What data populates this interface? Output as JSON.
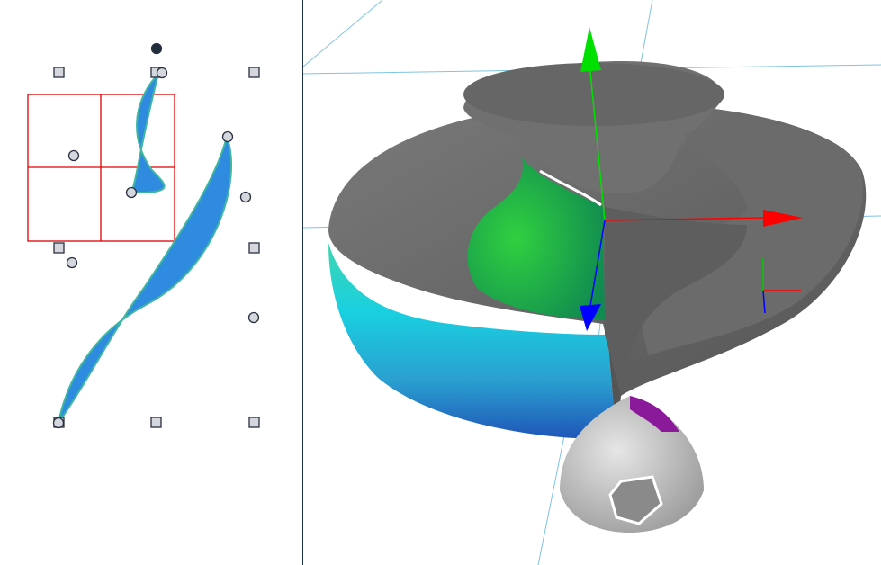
{
  "app": {
    "layout": "two-pane",
    "left_pane": "profile-curve-editor",
    "right_pane": "3d-viewport"
  },
  "profile_editor": {
    "grid_color": "#e00000",
    "curve_fill": "#2f8be0",
    "curve_stroke": "#3fb7a0",
    "handle_shape_squares": 9,
    "handle_shape_circles": 8,
    "handle_fill": "#d4d8de",
    "handle_stroke": "#2a3040",
    "active_handle_fill": "#1f2d3d"
  },
  "viewport": {
    "grid_line_color": "#7ec4e0",
    "gizmo": {
      "x_axis_color": "#ff0000",
      "y_axis_color": "#00e000",
      "z_axis_color": "#0000ff"
    },
    "mini_axes": {
      "x_color": "#ff0000",
      "y_color": "#00cc00",
      "z_color": "#0000ff"
    },
    "surface_colors": {
      "shell": "#6a6a6a",
      "inner_green": "#22b843",
      "band_cyan": "#19c8d8",
      "band_blue": "#2060c0",
      "cap": "#cfcfcf",
      "patch_purple": "#8a1a9a"
    }
  }
}
